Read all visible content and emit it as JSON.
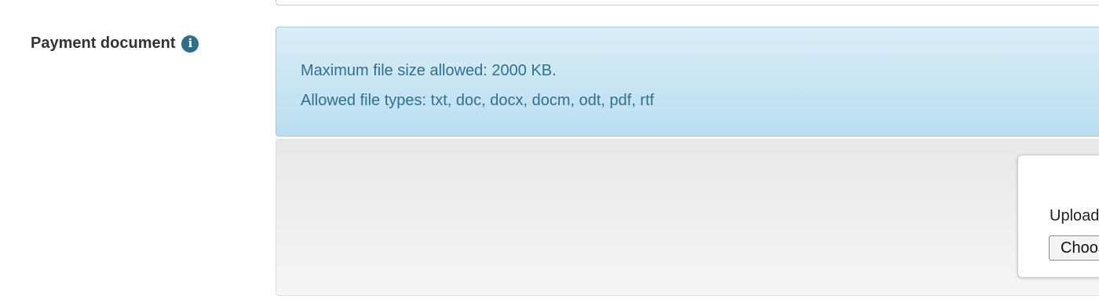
{
  "field": {
    "label": "Payment document",
    "info_icon": "info-icon",
    "info_glyph": "i"
  },
  "alert": {
    "max_size": "Maximum file size allowed: 2000 KB.",
    "allowed_types": "Allowed file types: txt, doc, docx, docm, odt, pdf, rtf",
    "text_color": "#31708f",
    "bg_color": "#d9edf7"
  },
  "upload": {
    "label": "Upload",
    "button_label": "Choose File"
  }
}
